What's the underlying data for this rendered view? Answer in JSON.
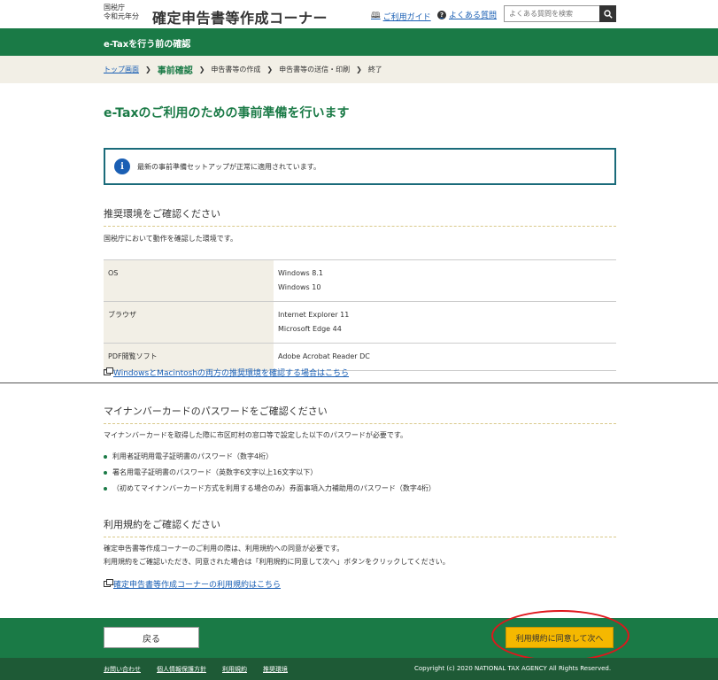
{
  "header": {
    "agency_line1": "国税庁",
    "agency_line2": "令和元年分",
    "title": "確定申告書等作成コーナー",
    "guide_link": "ご利用ガイド",
    "faq_link": "よくある質問",
    "search_placeholder": "よくある質問を検索"
  },
  "greenbar": {
    "title": "e-Taxを行う前の確認"
  },
  "steps": {
    "items": [
      "トップ画面",
      "事前確認",
      "申告書等の作成",
      "申告書等の送信・印刷",
      "終了"
    ],
    "current_index": 1
  },
  "page_heading": "e-Taxのご利用のための事前準備を行います",
  "info_message": "最新の事前準備セットアップが正常に適用されています。",
  "env_section": {
    "title": "推奨環境をご確認ください",
    "description": "国税庁において動作を確認した環境です。",
    "rows": [
      {
        "label": "OS",
        "line1": "Windows 8.1",
        "line2": "Windows 10"
      },
      {
        "label": "ブラウザ",
        "line1": "Internet Explorer 11",
        "line2": "Microsoft Edge 44"
      },
      {
        "label": "PDF閲覧ソフト",
        "line1": "Adobe Acrobat Reader DC",
        "line2": ""
      }
    ],
    "link": "WindowsとMacintoshの両方の推奨環境を確認する場合はこちら"
  },
  "password_section": {
    "title": "マイナンバーカードのパスワードをご確認ください",
    "description": "マイナンバーカードを取得した際に市区町村の窓口等で設定した以下のパスワードが必要です。",
    "items": [
      "利用者証明用電子証明書のパスワード（数字4桁）",
      "署名用電子証明書のパスワード（英数字6文字以上16文字以下）",
      "（初めてマイナンバーカード方式を利用する場合のみ）券面事項入力補助用のパスワード（数字4桁）"
    ]
  },
  "terms_section": {
    "title": "利用規約をご確認ください",
    "line1": "確定申告書等作成コーナーのご利用の際は、利用規約への同意が必要です。",
    "line2": "利用規約をご確認いただき、同意された場合は「利用規約に同意して次へ」ボタンをクリックしてください。",
    "link": "確定申告書等作成コーナーの利用規約はこちら"
  },
  "actions": {
    "back_label": "戻る",
    "next_label": "利用規約に同意して次へ"
  },
  "footer": {
    "links": [
      "お問い合わせ",
      "個人情報保護方針",
      "利用規約",
      "推奨環境"
    ],
    "copyright": "Copyright (c) 2020 NATIONAL TAX AGENCY All Rights Reserved."
  },
  "colors": {
    "brand_green": "#1a7a46",
    "footer_green": "#1e5a36",
    "accent_yellow": "#f5b800",
    "highlight_red": "#e0161c",
    "link_blue": "#1a5fb4"
  }
}
